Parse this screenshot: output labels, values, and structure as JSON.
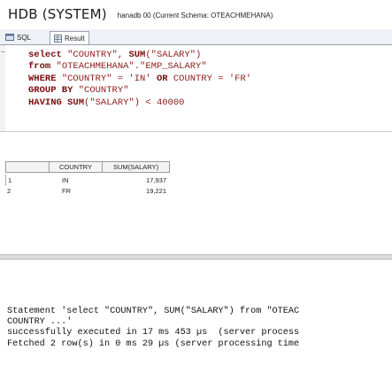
{
  "title": {
    "main": "HDB (SYSTEM)",
    "sub": "hanadb 00 (Current Schema: OTEACHMEHANA)"
  },
  "tabs": [
    {
      "label": "SQL",
      "icon": "sql-icon"
    },
    {
      "label": "Result",
      "icon": "result-icon"
    }
  ],
  "editor": {
    "lines": [
      [
        "select",
        " \"COUNTRY\", ",
        "SUM",
        "(\"SALARY\")"
      ],
      [
        "from",
        " \"OTEACHMEHANA\".\"EMP_SALARY\""
      ],
      [
        "WHERE",
        " \"COUNTRY\" = 'IN' ",
        "OR",
        " COUNTRY = 'FR'"
      ],
      [
        "GROUP BY",
        " \"COUNTRY\""
      ],
      [
        "HAVING",
        " ",
        "SUM",
        "(\"SALARY\") < 40000"
      ]
    ]
  },
  "grid": {
    "columns": [
      "COUNTRY",
      "SUM(SALARY)"
    ],
    "rows": [
      {
        "index": "1",
        "country": "IN",
        "sum": "17,937"
      },
      {
        "index": "2",
        "country": "FR",
        "sum": "19,221"
      }
    ]
  },
  "console": {
    "lines": [
      "Statement 'select \"COUNTRY\", SUM(\"SALARY\") from \"OTEAC",
      "COUNTRY ...'",
      "successfully executed in 17 ms 453 µs  (server process",
      "Fetched 2 row(s) in 0 ms 29 µs (server processing time"
    ]
  }
}
